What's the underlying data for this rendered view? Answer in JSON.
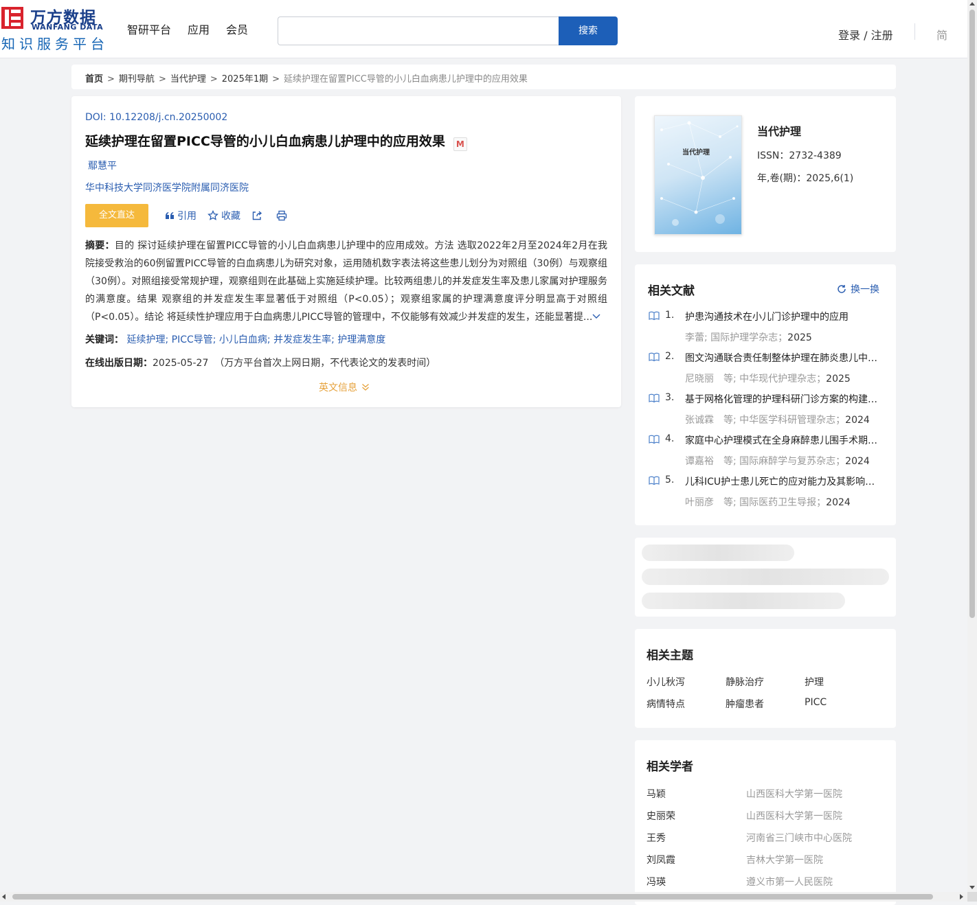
{
  "header": {
    "logo_cn": "万方数据",
    "logo_en": "WANFANG DATA",
    "logo_sub": "知识服务平台",
    "nav": [
      "智研平台",
      "应用",
      "会员"
    ],
    "search_placeholder": "",
    "search_button": "搜索",
    "login": "登录 / 注册",
    "lang": "简"
  },
  "breadcrumb": {
    "items": [
      "首页",
      "期刊导航",
      "当代护理",
      "2025年1期"
    ],
    "current": "延续护理在留置PICC导管的小儿白血病患儿护理中的应用效果"
  },
  "article": {
    "doi_label": "DOI: ",
    "doi": "10.12208/j.cn.20250002",
    "title": "延续护理在留置PICC导管的小儿白血病患儿护理中的应用效果",
    "badge": "M",
    "author": "鄢慧平",
    "organization": "华中科技大学同济医学院附属同济医院",
    "actions": {
      "fulltext": "全文直达",
      "cite": "引用",
      "favorite": "收藏"
    },
    "abstract_label": "摘要：",
    "abstract": "目的 探讨延续护理在留置PICC导管的小儿白血病患儿护理中的应用成效。方法 选取2022年2月至2024年2月在我院接受救治的60例留置PICC导管的白血病患儿为研究对象，运用随机数字表法将这些患儿划分为对照组（30例）与观察组（30例）。对照组接受常规护理，观察组则在此基础上实施延续护理。比较两组患儿的并发症发生率及患儿家属对护理服务的满意度。结果 观察组的并发症发生率显著低于对照组（P<0.05）；观察组家属的护理满意度评分明显高于对照组（P<0.05）。结论 将延续性护理应用于白血病患儿PICC导管的管理中，不仅能够有效减少并发症的发生，还能显著提...",
    "keywords_label": "关键词：",
    "keywords": [
      "延续护理",
      "PICC导管",
      "小儿白血病",
      "并发症发生率",
      "护理满意度"
    ],
    "pub_label": "在线出版日期：",
    "pub_date": "2025-05-27",
    "pub_note": "（万方平台首次上网日期，不代表论文的发表时间）",
    "en_info": "英文信息"
  },
  "journal": {
    "name": "当代护理",
    "cover_title": "当代护理",
    "issn": "ISSN：2732-4389",
    "volume": "年,卷(期)：2025,6(1)"
  },
  "related": {
    "title": "相关文献",
    "refresh": "换一换",
    "items": [
      {
        "num": "1.",
        "title": "护患沟通技术在小儿门诊护理中的应用",
        "meta": "李蕾; 国际护理学杂志；",
        "year": "2025"
      },
      {
        "num": "2.",
        "title": "图文沟通联合责任制整体护理在肺炎患儿中的应用效果",
        "meta": "尼晓丽　等; 中华现代护理杂志；",
        "year": "2025"
      },
      {
        "num": "3.",
        "title": "基于网格化管理的护理科研门诊方案的构建与应用",
        "meta": "张诚霖　等; 中华医学科研管理杂志；",
        "year": "2024"
      },
      {
        "num": "4.",
        "title": "家庭中心护理模式在全身麻醉患儿围手术期的应用",
        "meta": "谭嘉裕　等; 国际麻醉学与复苏杂志；",
        "year": "2024"
      },
      {
        "num": "5.",
        "title": "儿科ICU护士患儿死亡的应对能力及其影响因素研究",
        "meta": "叶丽彦　等; 国际医药卫生导报；",
        "year": "2024"
      }
    ]
  },
  "topics": {
    "title": "相关主题",
    "items": [
      "小儿秋泻",
      "静脉治疗",
      "护理",
      "病情特点",
      "肿瘤患者",
      "PICC"
    ]
  },
  "scholars": {
    "title": "相关学者",
    "items": [
      {
        "name": "马颖",
        "org": "山西医科大学第一医院"
      },
      {
        "name": "史丽荣",
        "org": "山西医科大学第一医院"
      },
      {
        "name": "王秀",
        "org": "河南省三门峡市中心医院"
      },
      {
        "name": "刘凤霞",
        "org": "吉林大学第一医院"
      },
      {
        "name": "冯瑛",
        "org": "遵义市第一人民医院"
      }
    ]
  },
  "colors": {
    "link": "#2a5db0",
    "accent_orange": "#f5b93c",
    "search_button": "#1d5fb8",
    "logo_red": "#d9232d"
  }
}
